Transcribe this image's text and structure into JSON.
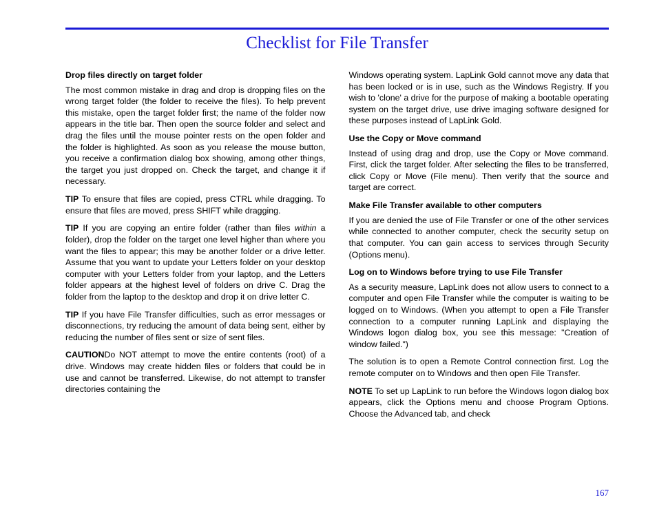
{
  "title": "Checklist for File Transfer",
  "page_number": "167",
  "left": {
    "h1": "Drop files directly on target folder",
    "p1": "The most common mistake in drag and drop is dropping files on the wrong target folder (the folder to receive the files). To help prevent this mistake, open the target folder first; the name of the folder now appears in the title bar. Then open the source folder and select and drag the files until the mouse pointer rests on the open folder and the folder is highlighted. As soon as you release the mouse button, you receive a confirmation dialog box showing, among other things, the target you just dropped on. Check the target, and change it if necessary.",
    "tip1_label": "TIP",
    "tip1_text": " To ensure that files are copied, press CTRL while dragging. To ensure that files are moved, press SHIFT while dragging.",
    "tip2_label": "TIP",
    "tip2_pre": " If you are copying an entire folder (rather than files ",
    "tip2_italic": "within",
    "tip2_post": " a folder), drop the folder on the target one level higher than where you want the files to appear; this may be another folder or a drive letter. Assume that you want to update your Letters folder on your desktop computer with your Letters folder from your laptop, and the Letters folder appears at the highest level of folders on drive C. Drag the folder from the laptop to the desktop and drop it on drive letter C.",
    "tip3_label": "TIP",
    "tip3_text": " If you have File Transfer difficulties, such as error messages or disconnections, try reducing the amount of data being sent, either by reducing the number of files sent or size of sent files.",
    "caution_label": "CAUTION",
    "caution_text": "Do NOT attempt to move the entire contents (root) of a drive. Windows may create hidden files or folders that could be in use and cannot be transferred. Likewise, do not attempt to transfer directories containing the"
  },
  "right": {
    "p0": "Windows operating system. LapLink Gold cannot move any data that has been locked or is in use, such as the Windows Registry. If you wish to 'clone' a drive for the purpose of making a bootable operating system on the target drive, use drive imaging software designed for these purposes instead of LapLink Gold.",
    "h2": "Use the Copy or Move command",
    "p2": "Instead of using drag and drop, use the Copy or Move command. First, click the target folder. After selecting the files to be transferred, click Copy or Move (File menu). Then verify that the source and target are correct.",
    "h3": "Make File Transfer available to other computers",
    "p3": "If you are denied the use of File Transfer or one of the other services while connected to another computer, check the security setup on that computer. You can gain access to services through Security (Options menu).",
    "h4": "Log on to Windows before trying to use File Transfer",
    "p4": "As a security measure, LapLink does not allow users to connect to a computer and open File Transfer while the computer is waiting to be logged on to Windows. (When you attempt to open a File Transfer connection to a computer running LapLink and displaying the Windows logon dialog box, you see this message: \"Creation of window failed.\")",
    "p5": "The solution is to open a Remote Control connection first. Log the remote computer on to Windows and then open File Transfer.",
    "note_label": "NOTE",
    "note_text": " To set up LapLink to run before the Windows logon dialog box appears, click the Options menu and choose Program Options. Choose the Advanced tab, and check"
  }
}
